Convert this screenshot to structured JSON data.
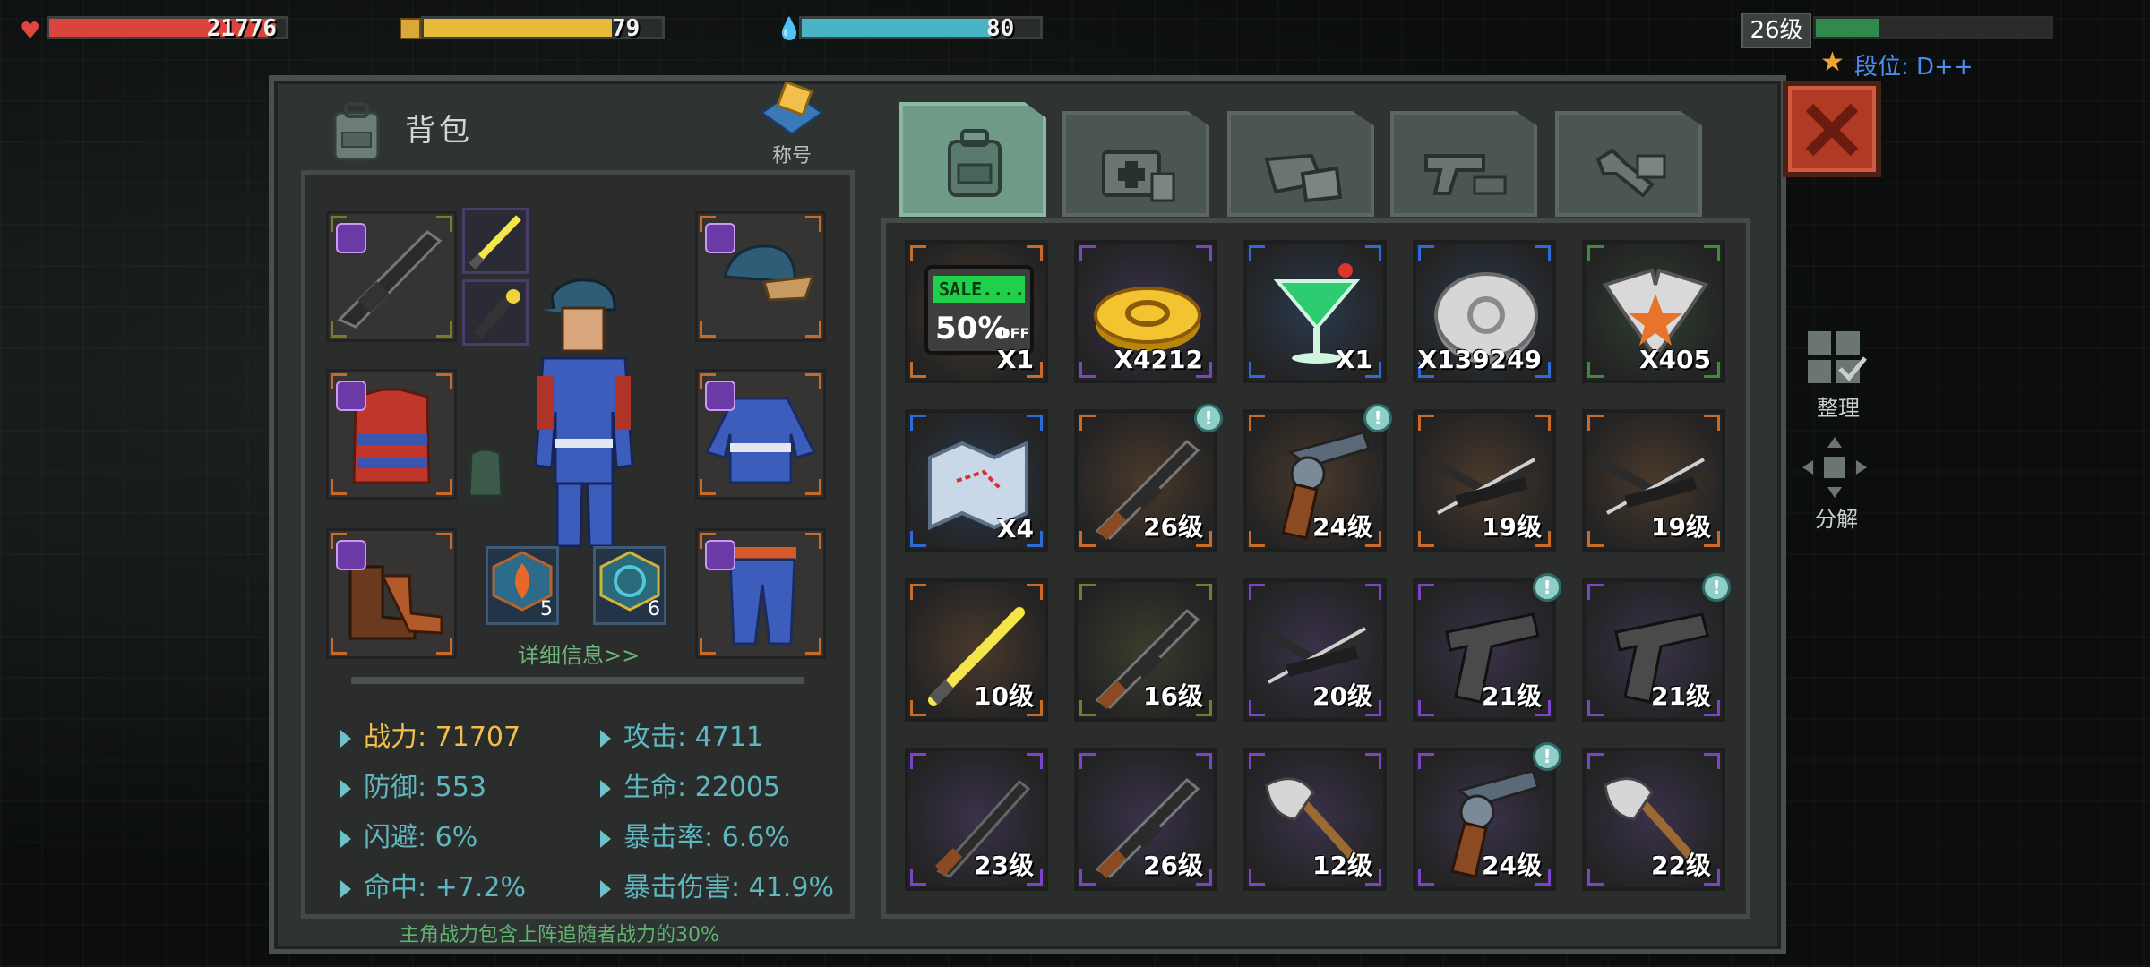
{
  "hud": {
    "health": {
      "value": "21776",
      "fill": 0.96,
      "color": "#d9453d"
    },
    "hunger": {
      "value": "79",
      "fill": 0.79,
      "color": "#e9b93a"
    },
    "water": {
      "value": "80",
      "fill": 0.8,
      "color": "#49b4c4"
    },
    "level": {
      "label": "26级",
      "fill": 0.27,
      "color": "#2f8a4c"
    },
    "rank": {
      "label": "段位: D++"
    }
  },
  "panel": {
    "title": "背包",
    "title_badge": "称号",
    "tabs": [
      {
        "name": "backpack",
        "active": true
      },
      {
        "name": "medical",
        "active": false
      },
      {
        "name": "materials",
        "active": false
      },
      {
        "name": "weapons",
        "active": false
      },
      {
        "name": "tools",
        "active": false
      }
    ]
  },
  "equipment": {
    "badges": [
      {
        "value": "5"
      },
      {
        "value": "6"
      }
    ],
    "detail_link": "详细信息>>"
  },
  "stats": [
    {
      "label": "战力",
      "value": "71707",
      "gold": true
    },
    {
      "label": "攻击",
      "value": "4711"
    },
    {
      "label": "防御",
      "value": "553"
    },
    {
      "label": "生命",
      "value": "22005"
    },
    {
      "label": "闪避",
      "value": "6%"
    },
    {
      "label": "暴击率",
      "value": "6.6%"
    },
    {
      "label": "命中",
      "value": "+7.2%"
    },
    {
      "label": "暴击伤害",
      "value": "41.9%"
    }
  ],
  "footnote": "主角战力包含上阵追随者战力的30%",
  "inventory": [
    {
      "icon": "sale-coupon-icon",
      "qty": "X1",
      "rarity": "orange",
      "alert": false
    },
    {
      "icon": "gold-coin-icon",
      "qty": "X4212",
      "rarity": "purple",
      "alert": false
    },
    {
      "icon": "cocktail-icon",
      "qty": "X1",
      "rarity": "blue",
      "alert": false
    },
    {
      "icon": "silver-coin-icon",
      "qty": "X139249",
      "rarity": "blue",
      "alert": false
    },
    {
      "icon": "eagle-emblem-icon",
      "qty": "X405",
      "rarity": "green",
      "alert": false
    },
    {
      "icon": "map-icon",
      "qty": "X4",
      "rarity": "blue",
      "alert": false
    },
    {
      "icon": "rifle-icon",
      "qty": "26级",
      "rarity": "orange",
      "alert": true
    },
    {
      "icon": "revolver-icon",
      "qty": "24级",
      "rarity": "orange",
      "alert": true
    },
    {
      "icon": "crossbow-icon",
      "qty": "19级",
      "rarity": "orange",
      "alert": false
    },
    {
      "icon": "crossbow-icon",
      "qty": "19级",
      "rarity": "orange",
      "alert": false
    },
    {
      "icon": "lightsaber-icon",
      "qty": "10级",
      "rarity": "orange",
      "alert": false
    },
    {
      "icon": "rifle-icon",
      "qty": "16级",
      "rarity": "olive",
      "alert": false
    },
    {
      "icon": "crossbow-icon",
      "qty": "20级",
      "rarity": "purple",
      "alert": false
    },
    {
      "icon": "pistol-icon",
      "qty": "21级",
      "rarity": "purple",
      "alert": true
    },
    {
      "icon": "pistol-icon",
      "qty": "21级",
      "rarity": "purple",
      "alert": true
    },
    {
      "icon": "shotgun-icon",
      "qty": "23级",
      "rarity": "purple",
      "alert": false
    },
    {
      "icon": "rifle-icon",
      "qty": "26级",
      "rarity": "purple",
      "alert": false
    },
    {
      "icon": "axe-icon",
      "qty": "12级",
      "rarity": "purple",
      "alert": false
    },
    {
      "icon": "revolver-icon",
      "qty": "24级",
      "rarity": "purple",
      "alert": true
    },
    {
      "icon": "axe-icon",
      "qty": "22级",
      "rarity": "purple",
      "alert": false
    }
  ],
  "alert_mark": "!",
  "side": {
    "sort_label": "整理",
    "dismantle_label": "分解"
  },
  "rarity_colors": {
    "orange": "#c86b2a",
    "purple": "#7a44c4",
    "blue": "#2d6ad8",
    "green": "#3e8b3e",
    "olive": "#7b7a2c"
  }
}
